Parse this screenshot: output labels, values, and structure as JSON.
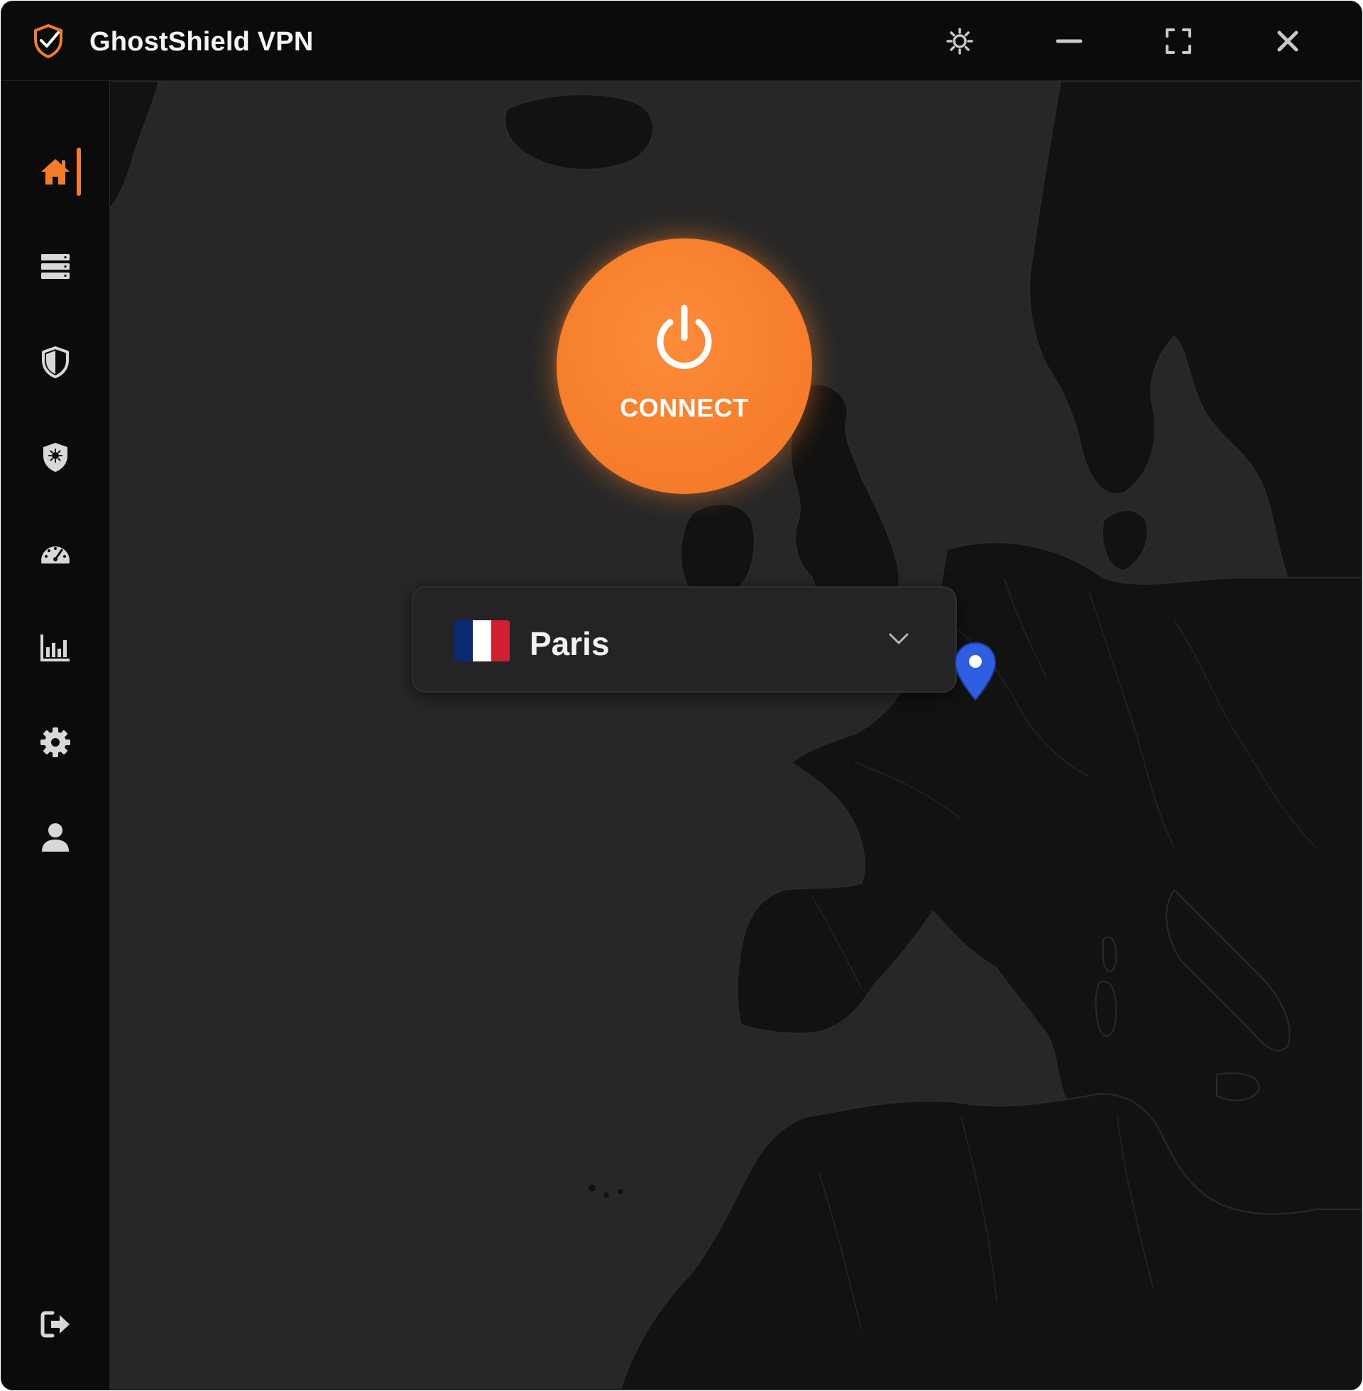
{
  "app": {
    "title": "GhostShield VPN",
    "accent_color": "#f57d2a",
    "logo_icon": "shield-check-icon"
  },
  "titlebar": {
    "buttons": [
      {
        "name": "theme-toggle",
        "icon": "sun-icon"
      },
      {
        "name": "minimize",
        "icon": "minimize-icon"
      },
      {
        "name": "fullscreen",
        "icon": "fullscreen-icon"
      },
      {
        "name": "close",
        "icon": "close-icon"
      }
    ]
  },
  "sidebar": {
    "items": [
      {
        "name": "home",
        "icon": "home-icon",
        "active": true
      },
      {
        "name": "servers",
        "icon": "server-list-icon",
        "active": false
      },
      {
        "name": "protection",
        "icon": "shield-icon",
        "active": false
      },
      {
        "name": "threat-protection",
        "icon": "shield-virus-icon",
        "active": false
      },
      {
        "name": "speed-test",
        "icon": "speedometer-icon",
        "active": false
      },
      {
        "name": "statistics",
        "icon": "bar-chart-icon",
        "active": false
      },
      {
        "name": "settings",
        "icon": "gear-icon",
        "active": false
      },
      {
        "name": "account",
        "icon": "user-icon",
        "active": false
      }
    ],
    "bottom_item": {
      "name": "logout",
      "icon": "logout-icon"
    }
  },
  "connect": {
    "label": "CONNECT",
    "icon": "power-icon",
    "color": "#f67e2c"
  },
  "location": {
    "name": "Paris",
    "flag_icon": "france-flag-icon",
    "flag_colors": [
      "#0a2a6e",
      "#ffffff",
      "#d21f2f"
    ],
    "dropdown_icon": "chevron-down-icon"
  },
  "map": {
    "pin_icon": "map-pin-icon",
    "pin_color": "#2f5fe0"
  }
}
